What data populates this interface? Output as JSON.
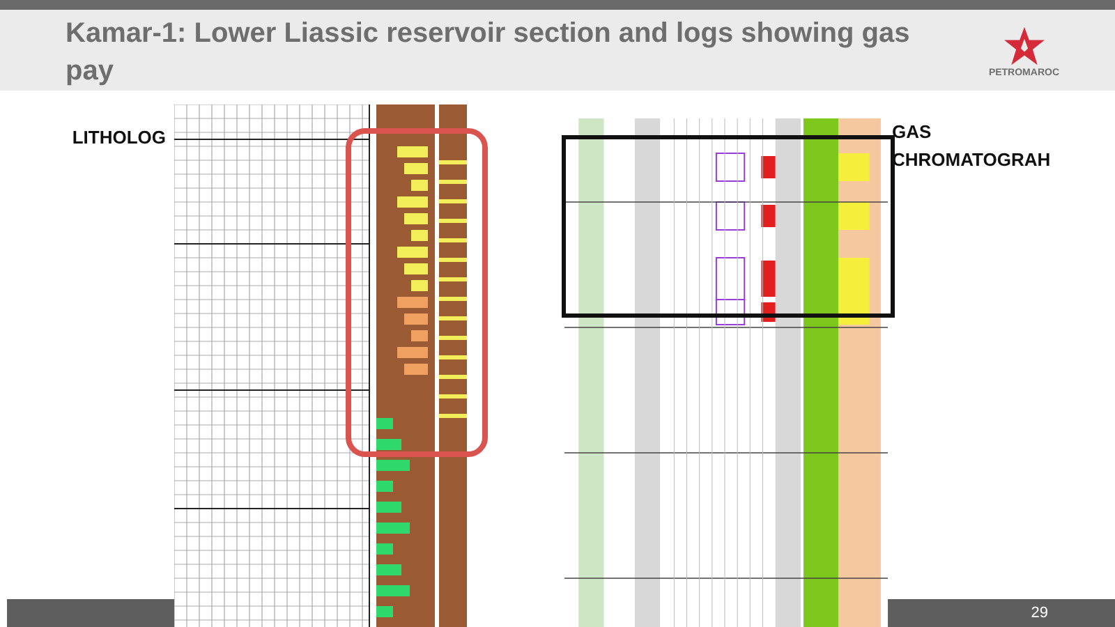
{
  "slide": {
    "title": "Kamar-1: Lower Liassic reservoir section and logs showing gas pay",
    "logo_text": "PETROMAROC"
  },
  "labels": [
    {
      "kind": "left",
      "text": "LITHOLOG"
    },
    {
      "kind": "right",
      "text": "GAS CHROMATOGRAH"
    }
  ],
  "footer": {
    "page_number": "29"
  }
}
